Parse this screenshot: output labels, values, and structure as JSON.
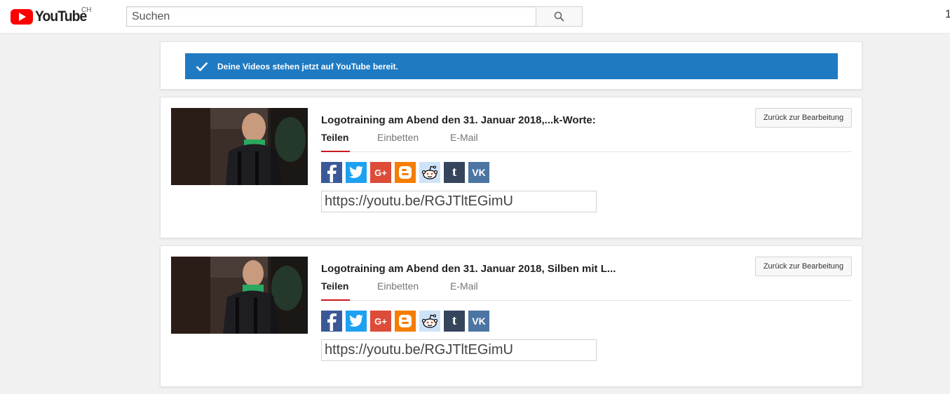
{
  "header": {
    "logo_text": "YouTube",
    "country_code": "CH",
    "search_placeholder": "Suchen",
    "search_icon": "search-icon",
    "right_mark": "1"
  },
  "notice": {
    "text": "Deine Videos stehen jetzt auf YouTube bereit.",
    "color": "#1f7ac2",
    "icon": "checkmark-icon"
  },
  "videos": [
    {
      "title": "Logotraining am Abend den 31. Januar 2018,...k-Worte:",
      "back_label": "Zurück zur Bearbeitung",
      "tabs": [
        "Teilen",
        "Einbetten",
        "E-Mail"
      ],
      "active_tab": "Teilen",
      "url": "https://youtu.be/RGJTltEGimU"
    },
    {
      "title": "Logotraining am Abend den 31. Januar 2018, Silben mit L...",
      "back_label": "Zurück zur Bearbeitung",
      "tabs": [
        "Teilen",
        "Einbetten",
        "E-Mail"
      ],
      "active_tab": "Teilen",
      "url": "https://youtu.be/RGJTltEGimU"
    }
  ],
  "share_services": [
    {
      "name": "facebook-icon",
      "color": "#3b5998"
    },
    {
      "name": "twitter-icon",
      "color": "#1da1f2"
    },
    {
      "name": "google-plus-icon",
      "color": "#dd4b39"
    },
    {
      "name": "blogger-icon",
      "color": "#f57d00"
    },
    {
      "name": "reddit-icon",
      "color": "#cee3f8"
    },
    {
      "name": "tumblr-icon",
      "color": "#35465c"
    },
    {
      "name": "vk-icon",
      "color": "#4c75a3"
    }
  ]
}
